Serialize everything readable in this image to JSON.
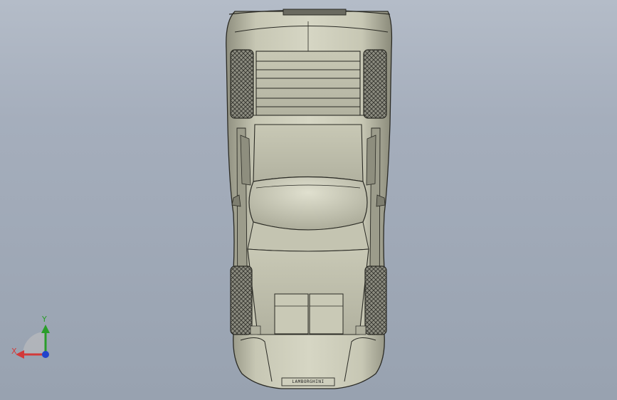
{
  "view": {
    "background_top": "#b4bcc8",
    "background_bottom": "#98a2b0",
    "model_fill": "#b9b9a6",
    "model_edge": "#2a2a24"
  },
  "model": {
    "name": "car-top-view",
    "rear_badge_text": "LAMBORGHINI"
  },
  "triad": {
    "x_label": "X",
    "y_label": "Y",
    "x_color": "#d23a3a",
    "y_color": "#2a9d2a",
    "z_color": "#2244cc"
  }
}
